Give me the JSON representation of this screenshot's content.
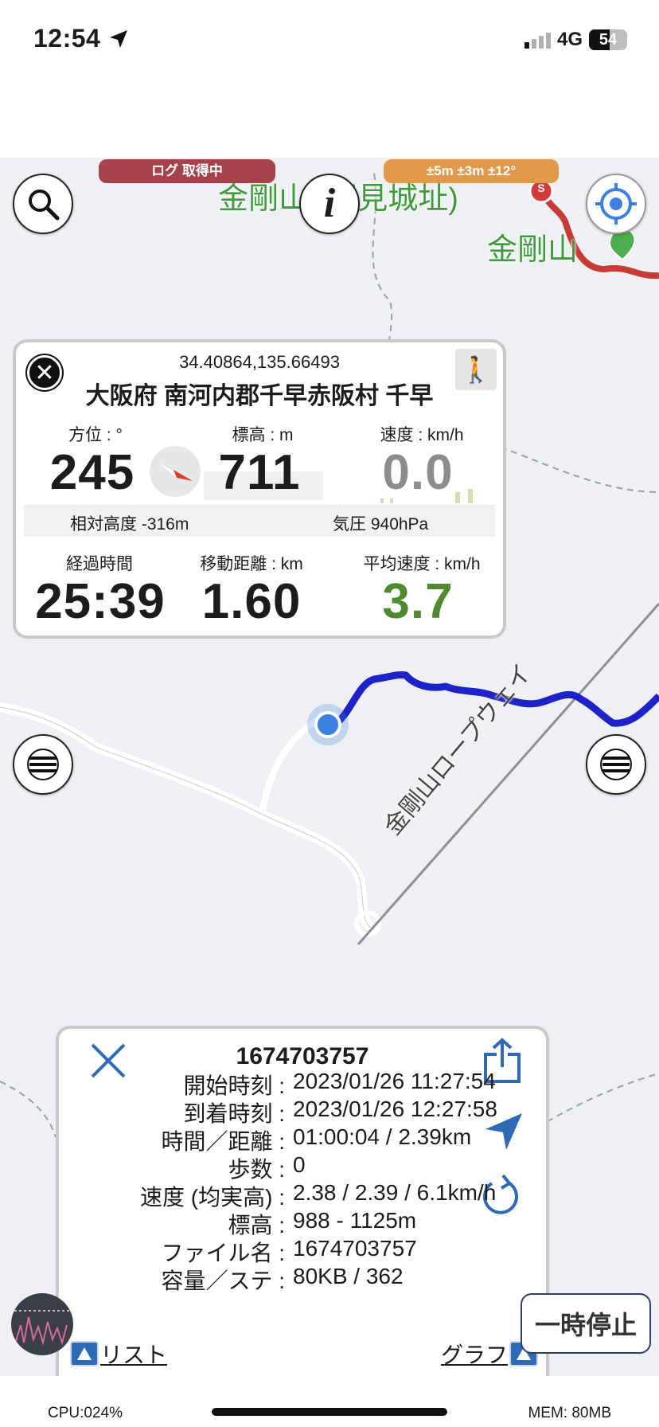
{
  "status_bar": {
    "time": "12:54",
    "network": "4G",
    "battery": "54",
    "icons": [
      "location-arrow-icon",
      "signal-icon",
      "battery-icon"
    ]
  },
  "map": {
    "labels": {
      "summit_label": "金剛山 (国見城址)",
      "mountain_label": "金剛山",
      "ropeway_label": "金剛山ロープウェイ"
    },
    "start_marker": "S",
    "log_pill": "ログ 取得中",
    "accuracy_pill": "±5m ±3m ±12°",
    "colors": {
      "current_track": "#1d22c9",
      "past_track": "#c83a36",
      "location_dot": "#3d7fe0",
      "map_label": "#3f9a3c"
    }
  },
  "info_card": {
    "coords": "34.40864,135.66493",
    "address": "大阪府 南河内郡千早赤阪村 千早",
    "bearing_label": "方位 : °",
    "bearing_value": "245",
    "elevation_label": "標高 : m",
    "elevation_value": "711",
    "speed_label": "速度 : km/h",
    "speed_value": "0.0",
    "relative_altitude": "相対高度 -316m",
    "pressure": "気圧 940hPa",
    "elapsed_label": "経過時間",
    "elapsed_value": "25:39",
    "distance_label": "移動距離 : km",
    "distance_value": "1.60",
    "avg_speed_label": "平均速度 : km/h",
    "avg_speed_value": "3.7",
    "colors": {
      "avg_speed": "#4e8a2e",
      "speed": "#8c8c8c"
    }
  },
  "log_panel": {
    "title": "1674703757",
    "rows": [
      {
        "key": "開始時刻 :",
        "value": "2023/01/26 11:27:54"
      },
      {
        "key": "到着時刻 :",
        "value": "2023/01/26 12:27:58"
      },
      {
        "key": "時間／距離 :",
        "value": "01:00:04 / 2.39km"
      },
      {
        "key": "歩数 :",
        "value": "0"
      },
      {
        "key": "速度 (均実高) :",
        "value": "2.38 / 2.39 / 6.1km/h"
      },
      {
        "key": "標高 :",
        "value": "988 - 1125m"
      },
      {
        "key": "ファイル名 :",
        "value": "1674703757"
      },
      {
        "key": "容量／ステ :",
        "value": "80KB / 362"
      }
    ],
    "list_link": "リスト",
    "graph_link": "グラフ",
    "accent": "#2e6ab6"
  },
  "pause_button": "一時停止",
  "footer": {
    "cpu": "CPU:024%",
    "mem": "MEM: 80MB"
  }
}
